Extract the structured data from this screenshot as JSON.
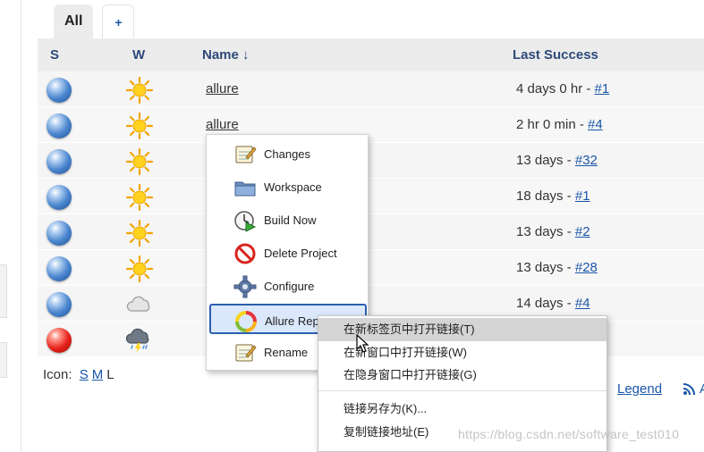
{
  "tabs": {
    "all_label": "All",
    "add_label": "+"
  },
  "columns": {
    "status": "S",
    "weather": "W",
    "name": "Name",
    "sort_indicator": "↓",
    "last_success": "Last Success"
  },
  "jobs": [
    {
      "status": "blue",
      "weather": "sunny",
      "name": "allure",
      "last_success": "4 days 0 hr - ",
      "build": "#1"
    },
    {
      "status": "blue",
      "weather": "sunny",
      "name": "allure",
      "last_success": "2 hr 0 min - ",
      "build": "#4"
    },
    {
      "status": "blue",
      "weather": "sunny",
      "name": "",
      "last_success": "13 days - ",
      "build": "#32"
    },
    {
      "status": "blue",
      "weather": "sunny",
      "name": "",
      "last_success": "18 days - ",
      "build": "#1"
    },
    {
      "status": "blue",
      "weather": "sunny",
      "name": "",
      "last_success": "13 days - ",
      "build": "#2"
    },
    {
      "status": "blue",
      "weather": "sunny",
      "name": "",
      "last_success": "13 days - ",
      "build": "#28"
    },
    {
      "status": "blue",
      "weather": "cloudy",
      "name": "",
      "last_success": "14 days - ",
      "build": "#4"
    },
    {
      "status": "red",
      "weather": "storm",
      "name": "",
      "last_success": "",
      "build": ""
    }
  ],
  "icon_size": {
    "label": "Icon:",
    "s": "S",
    "m": "M",
    "l": "L"
  },
  "legend_label": "Legend",
  "rss_partial": "A",
  "context_menu": {
    "items": [
      {
        "label": "Changes",
        "icon": "notepad-icon"
      },
      {
        "label": "Workspace",
        "icon": "folder-icon"
      },
      {
        "label": "Build Now",
        "icon": "clock-play-icon"
      },
      {
        "label": "Delete Project",
        "icon": "no-entry-icon"
      },
      {
        "label": "Configure",
        "icon": "gear-icon"
      },
      {
        "label": "Allure Rep",
        "icon": "allure-icon"
      },
      {
        "label": "Rename",
        "icon": "notepad-icon"
      }
    ]
  },
  "browser_menu": {
    "items": [
      "在新标签页中打开链接(T)",
      "在新窗口中打开链接(W)",
      "在隐身窗口中打开链接(G)",
      "链接另存为(K)...",
      "复制链接地址(E)"
    ]
  },
  "watermark": "https://blog.csdn.net/software_test010"
}
